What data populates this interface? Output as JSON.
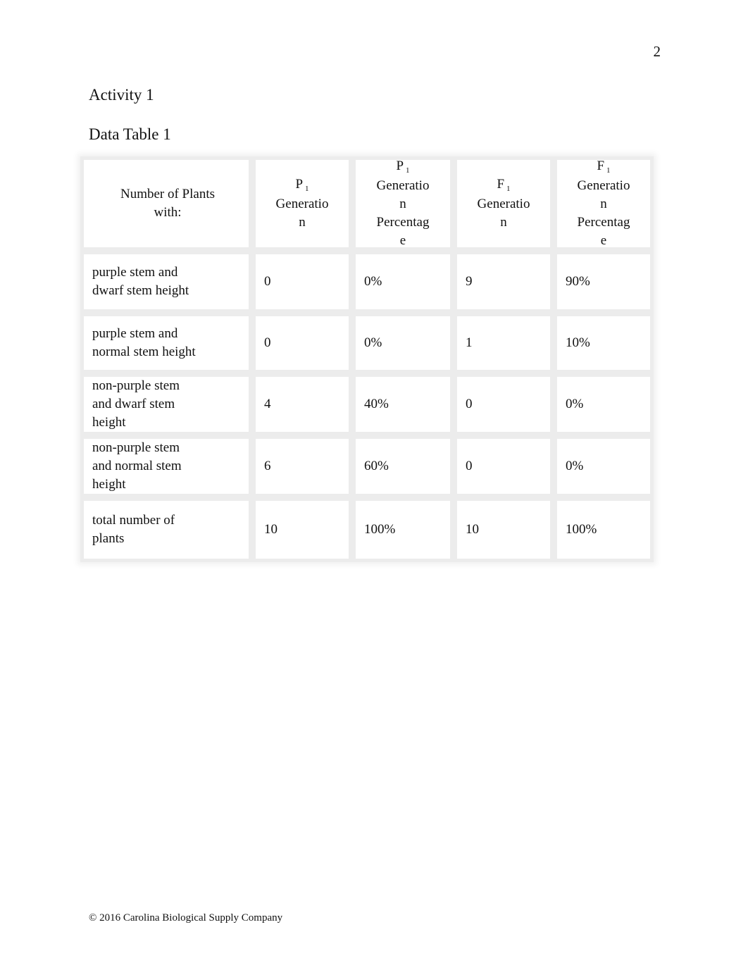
{
  "page": {
    "page_number": "2",
    "activity_heading": "Activity 1",
    "table_heading": "Data Table 1",
    "footer": "© 2016 Carolina Biological Supply Company"
  },
  "table": {
    "headers": [
      {
        "lines": [
          "Number of Plants",
          "with:"
        ]
      },
      {
        "symbol": "P",
        "subscript": "1",
        "lines": [
          "Generatio",
          "n"
        ]
      },
      {
        "symbol": "P",
        "subscript": "1",
        "lines": [
          "Generatio",
          "n",
          "Percentag",
          "e"
        ]
      },
      {
        "symbol": "F",
        "subscript": "1",
        "lines": [
          "Generatio",
          "n"
        ]
      },
      {
        "symbol": "F",
        "subscript": "1",
        "lines": [
          "Generatio",
          "n",
          "Percentag",
          "e"
        ]
      }
    ],
    "rows": [
      {
        "label": [
          "purple stem and",
          "dwarf stem height"
        ],
        "p1": "0",
        "p1_pct": "0%",
        "f1": "9",
        "f1_pct": "90%"
      },
      {
        "label": [
          "purple stem and",
          "normal stem height"
        ],
        "p1": "0",
        "p1_pct": "0%",
        "f1": "1",
        "f1_pct": "10%"
      },
      {
        "label": [
          "non-purple stem",
          "and dwarf stem",
          "height"
        ],
        "p1": "4",
        "p1_pct": "40%",
        "f1": "0",
        "f1_pct": "0%"
      },
      {
        "label": [
          "non-purple stem",
          "and normal stem",
          "height"
        ],
        "p1": "6",
        "p1_pct": "60%",
        "f1": "0",
        "f1_pct": "0%"
      },
      {
        "label": [
          "total number of",
          "plants"
        ],
        "p1": "10",
        "p1_pct": "100%",
        "f1": "10",
        "f1_pct": "100%"
      }
    ]
  }
}
